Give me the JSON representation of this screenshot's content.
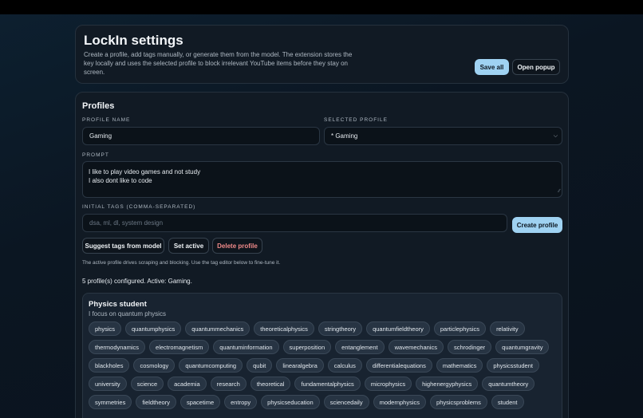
{
  "header": {
    "title": "LockIn settings",
    "description": "Create a profile, add tags manually, or generate them from the model. The extension stores the key locally and uses the selected profile to block irrelevant YouTube items before they stay on screen.",
    "save_all": "Save all",
    "open_popup": "Open popup"
  },
  "profiles": {
    "title": "Profiles",
    "profile_name_label": "PROFILE NAME",
    "profile_name_value": "Gaming",
    "selected_profile_label": "SELECTED PROFILE",
    "selected_profile_value": "* Gaming",
    "prompt_label": "PROMPT",
    "prompt_line1": "I like to play video games and not study",
    "prompt_line2": "I also dont like to code",
    "initial_tags_label": "INITIAL TAGS (COMMA-SEPARATED)",
    "initial_tags_placeholder": "dsa, ml, dl, system design",
    "create_profile": "Create profile",
    "suggest_tags": "Suggest tags from model",
    "set_active": "Set active",
    "delete_profile": "Delete profile",
    "note": "The active profile drives scraping and blocking. Use the tag editor below to fine-tune it.",
    "status": "5 profile(s) configured. Active: Gaming."
  },
  "profile_card": {
    "name": "Physics student",
    "description": "I focus on quantum physics",
    "tags": [
      "physics",
      "quantumphysics",
      "quantummechanics",
      "theoreticalphysics",
      "stringtheory",
      "quantumfieldtheory",
      "particlephysics",
      "relativity",
      "thermodynamics",
      "electromagnetism",
      "quantuminformation",
      "superposition",
      "entanglement",
      "wavemechanics",
      "schrodinger",
      "quantumgravity",
      "blackholes",
      "cosmology",
      "quantumcomputing",
      "qubit",
      "linearalgebra",
      "calculus",
      "differentialequations",
      "mathematics",
      "physicsstudent",
      "university",
      "science",
      "academia",
      "research",
      "theoretical",
      "fundamentalphysics",
      "microphysics",
      "highenergyphysics",
      "quantumtheory",
      "symmetries",
      "fieldtheory",
      "spacetime",
      "entropy",
      "physicseducation",
      "sciencedaily",
      "modernphysics",
      "physicsproblems",
      "student"
    ]
  }
}
